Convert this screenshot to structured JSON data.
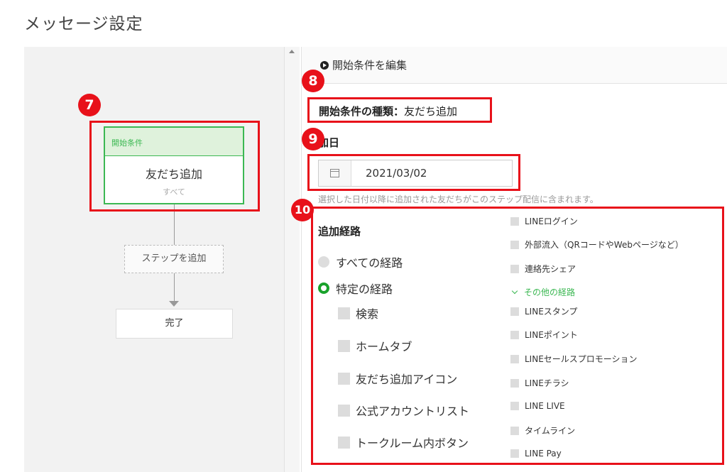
{
  "page": {
    "title": "メッセージ設定"
  },
  "flow": {
    "start": {
      "header": "開始条件",
      "title": "友だち追加",
      "subtitle": "すべて"
    },
    "add_step_label": "ステップを追加",
    "done_label": "完了"
  },
  "markers": [
    "7",
    "8",
    "9",
    "10"
  ],
  "settings": {
    "header_label": "開始条件を編集",
    "condition_type_label": "開始条件の種類：",
    "condition_type_value": "友だち追加",
    "date_label": "加日",
    "date_value": "2021/03/02",
    "date_note": "選択した日付以降に追加された友だちがこのステップ配信に含まれます。",
    "route_title": "追加経路",
    "radios": [
      {
        "label": "すべての経路",
        "selected": false
      },
      {
        "label": "特定の経路",
        "selected": true
      }
    ],
    "routes_left": [
      "検索",
      "ホームタブ",
      "友だち追加アイコン",
      "公式アカウントリスト",
      "トークルーム内ボタン"
    ],
    "routes_right_top": [
      "LINEログイン",
      "外部流入（QRコードやWebページなど）",
      "連絡先シェア"
    ],
    "more_routes_label": "その他の経路",
    "routes_right_more": [
      "LINEスタンプ",
      "LINEポイント",
      "LINEセールスプロモーション",
      "LINEチラシ",
      "LINE LIVE",
      "タイムライン",
      "LINE Pay"
    ]
  },
  "colors": {
    "accent_green": "#3cb853",
    "annotation_red": "#e8111a"
  }
}
